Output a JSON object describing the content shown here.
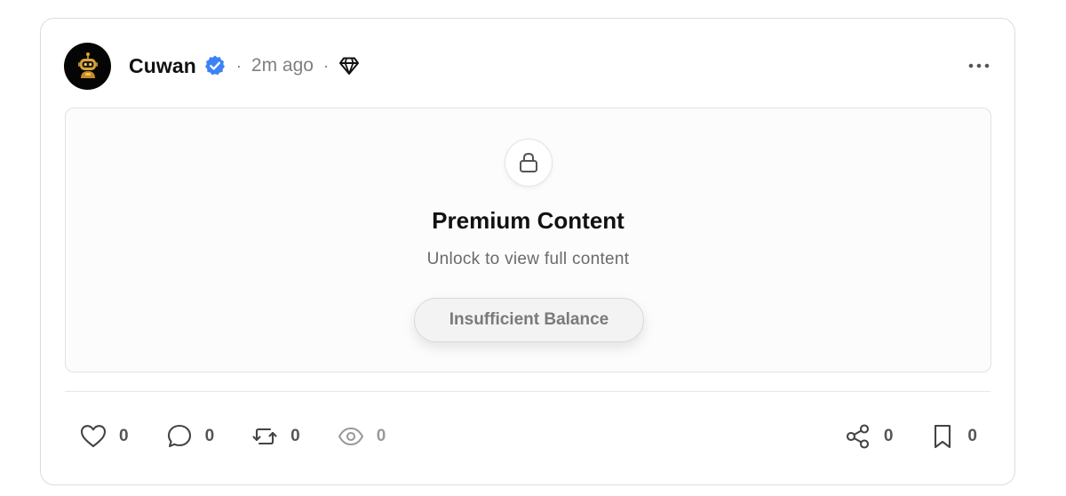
{
  "post": {
    "author": {
      "name": "Cuwan",
      "avatar_icon": "robot-mascot-icon",
      "verified_icon": "verified-badge-icon",
      "verified_color": "#3b82f6"
    },
    "timestamp": "2m ago",
    "separator": "·",
    "tier_icon": "diamond-icon",
    "menu_icon": "more-horizontal-icon"
  },
  "locked": {
    "icon": "lock-icon",
    "title": "Premium Content",
    "subtitle": "Unlock to view full content",
    "button_label": "Insufficient Balance"
  },
  "actions": {
    "like": {
      "icon": "heart-icon",
      "count": "0"
    },
    "comment": {
      "icon": "comment-icon",
      "count": "0"
    },
    "repost": {
      "icon": "repost-icon",
      "count": "0"
    },
    "views": {
      "icon": "eye-icon",
      "count": "0"
    },
    "share": {
      "icon": "share-icon",
      "count": "0"
    },
    "bookmark": {
      "icon": "bookmark-icon",
      "count": "0"
    }
  },
  "colors": {
    "card_border": "#dcdcdc",
    "text_primary": "#111111",
    "text_muted": "#808080",
    "avatar_bg": "#050505",
    "avatar_accent": "#d9a33a"
  }
}
